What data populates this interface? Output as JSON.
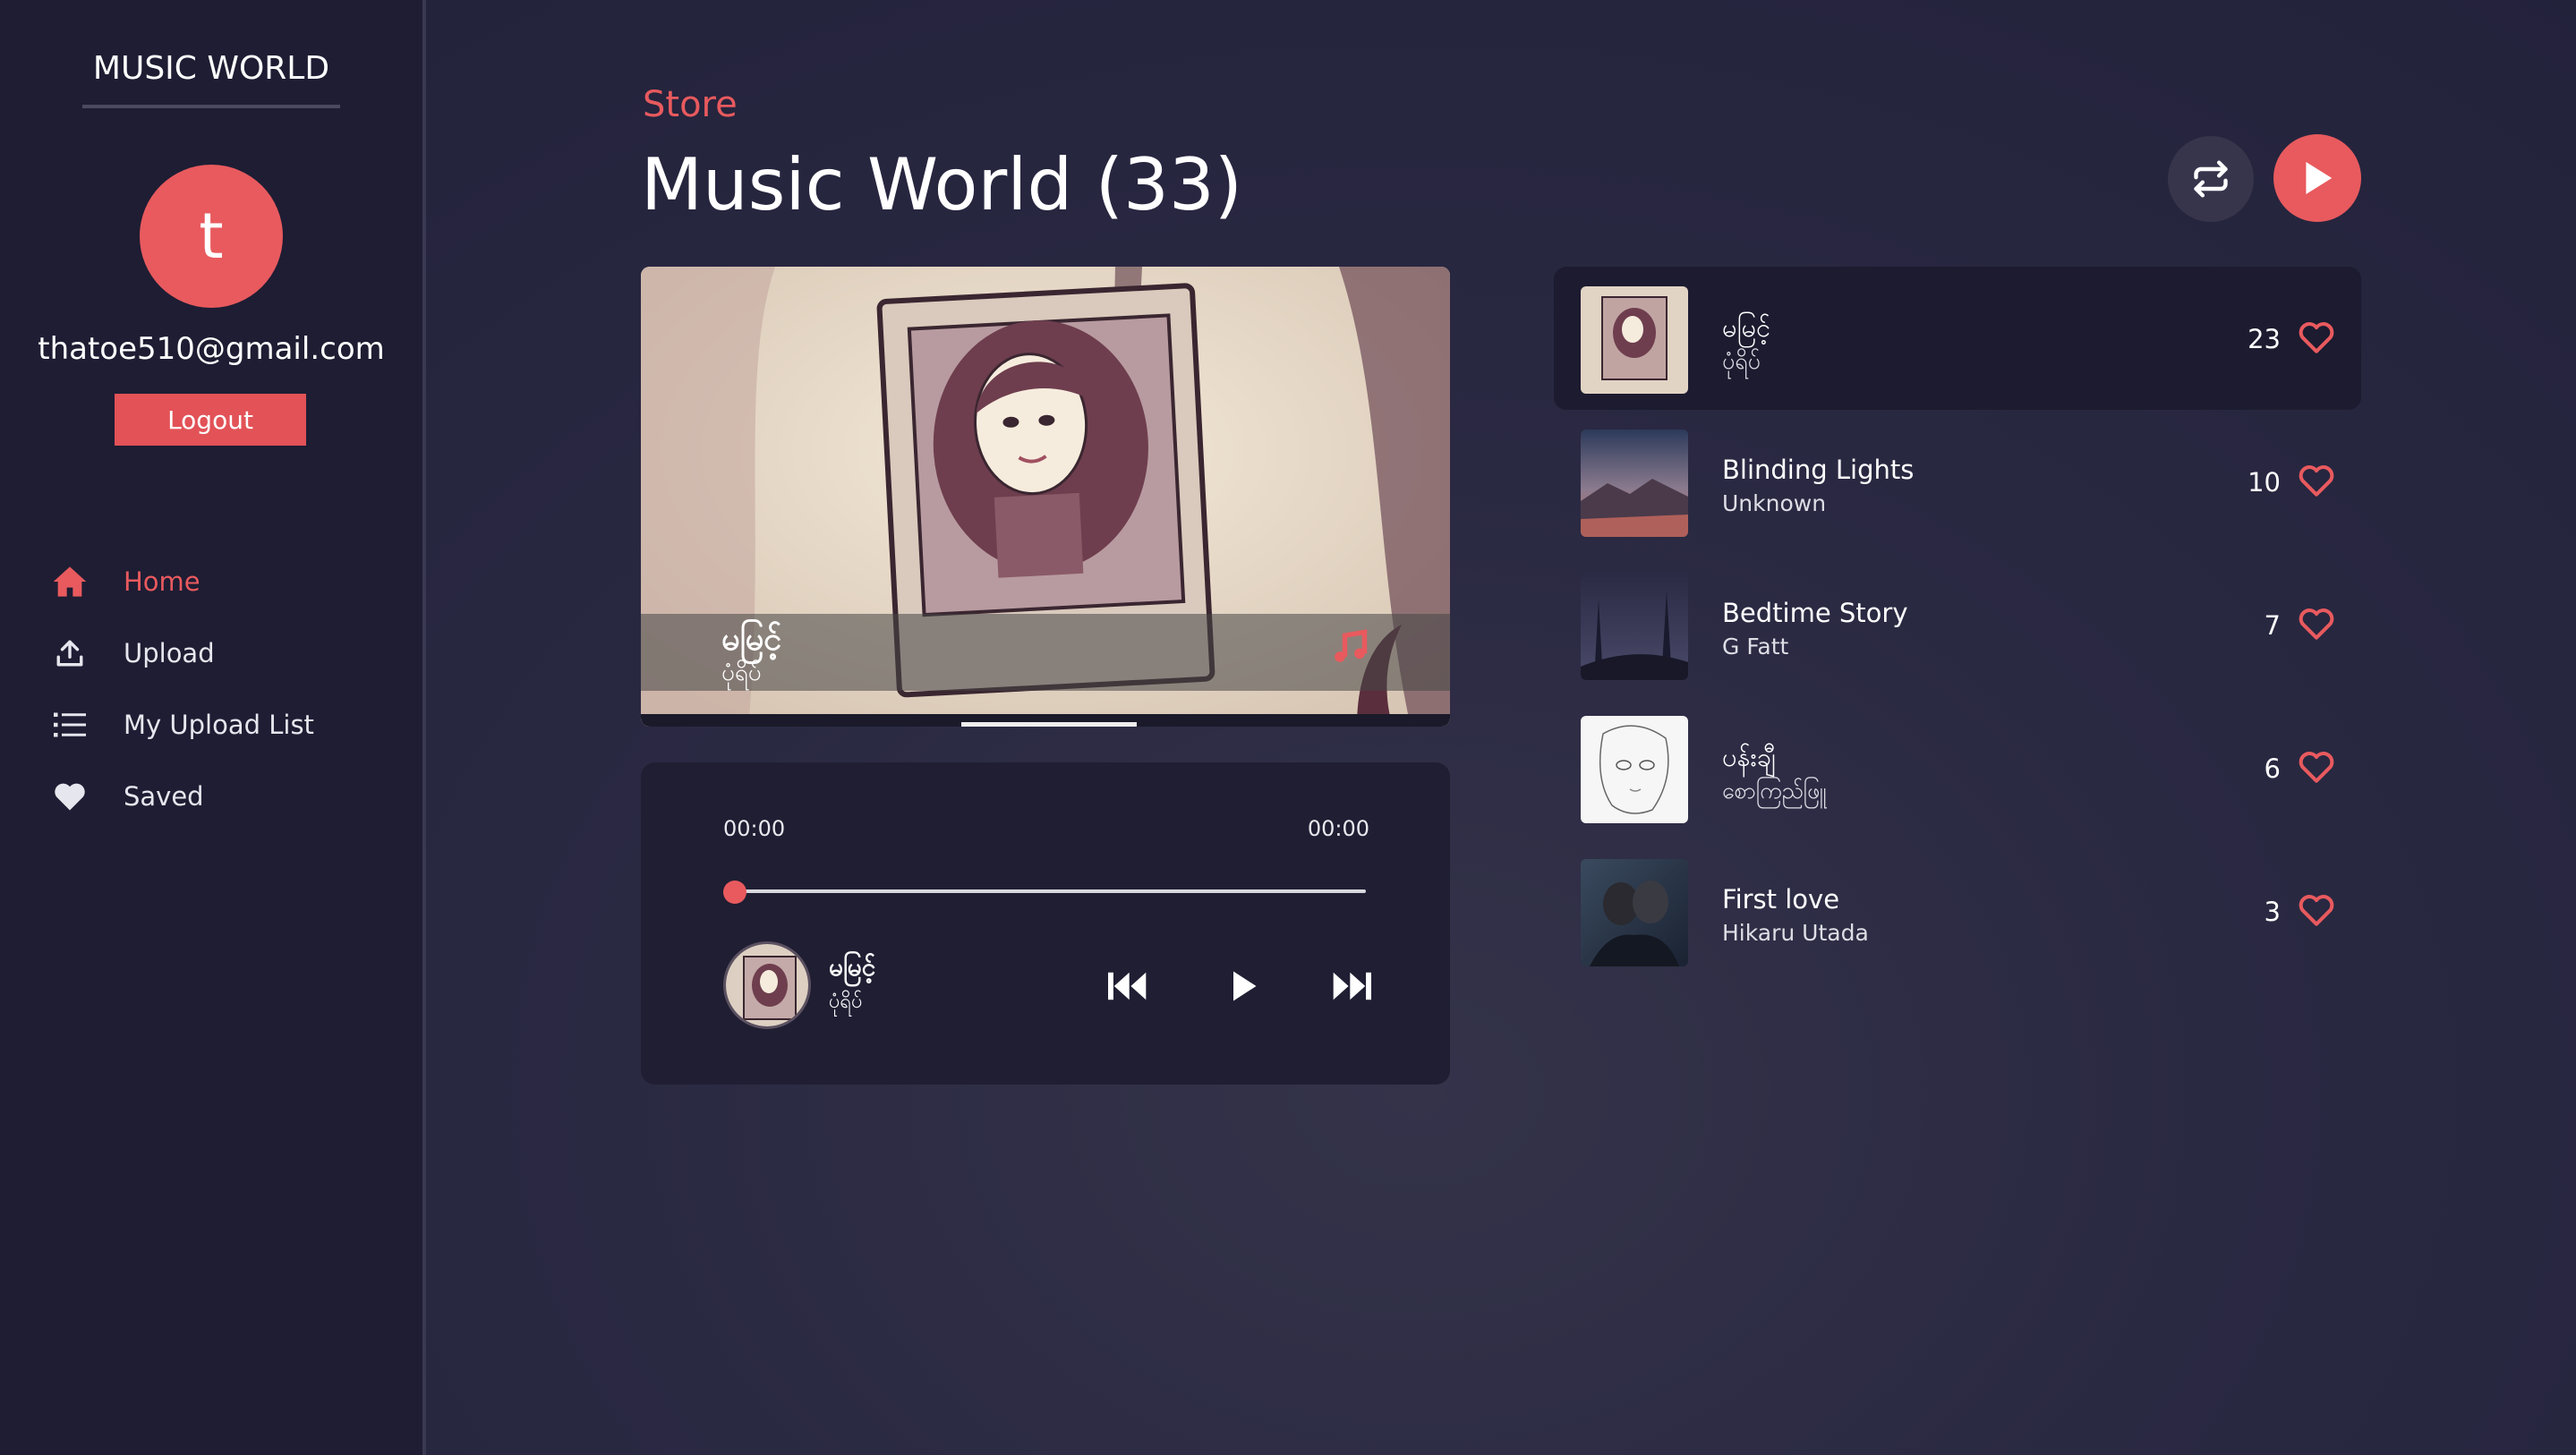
{
  "sidebar": {
    "brand": "MUSIC WORLD",
    "avatar_letter": "t",
    "email": "thatoe510@gmail.com",
    "logout_label": "Logout",
    "nav": [
      {
        "label": "Home",
        "icon": "home-icon",
        "active": true
      },
      {
        "label": "Upload",
        "icon": "upload-icon",
        "active": false
      },
      {
        "label": "My Upload List",
        "icon": "list-icon",
        "active": false
      },
      {
        "label": "Saved",
        "icon": "heart-icon",
        "active": false
      }
    ]
  },
  "header": {
    "section": "Store",
    "title": "Music World (33)"
  },
  "now_playing": {
    "title": "မမြင့်",
    "artist": "ပုံရိပ်",
    "current_time": "00:00",
    "duration": "00:00",
    "progress": 0
  },
  "songs": [
    {
      "title": "မမြင့်",
      "artist": "ပုံရိပ်",
      "likes": "23",
      "active": true
    },
    {
      "title": "Blinding Lights",
      "artist": "Unknown",
      "likes": "10",
      "active": false
    },
    {
      "title": "Bedtime Story",
      "artist": "G Fatt",
      "likes": "7",
      "active": false
    },
    {
      "title": "ပန်းချီ",
      "artist": "စောကြည်ဖြူ",
      "likes": "6",
      "active": false
    },
    {
      "title": "First love",
      "artist": "Hikaru Utada",
      "likes": "3",
      "active": false
    }
  ],
  "colors": {
    "accent": "#e85a5e",
    "background": "#22213a",
    "sidebar": "#1e1d33",
    "panel": "#1f1e33"
  }
}
